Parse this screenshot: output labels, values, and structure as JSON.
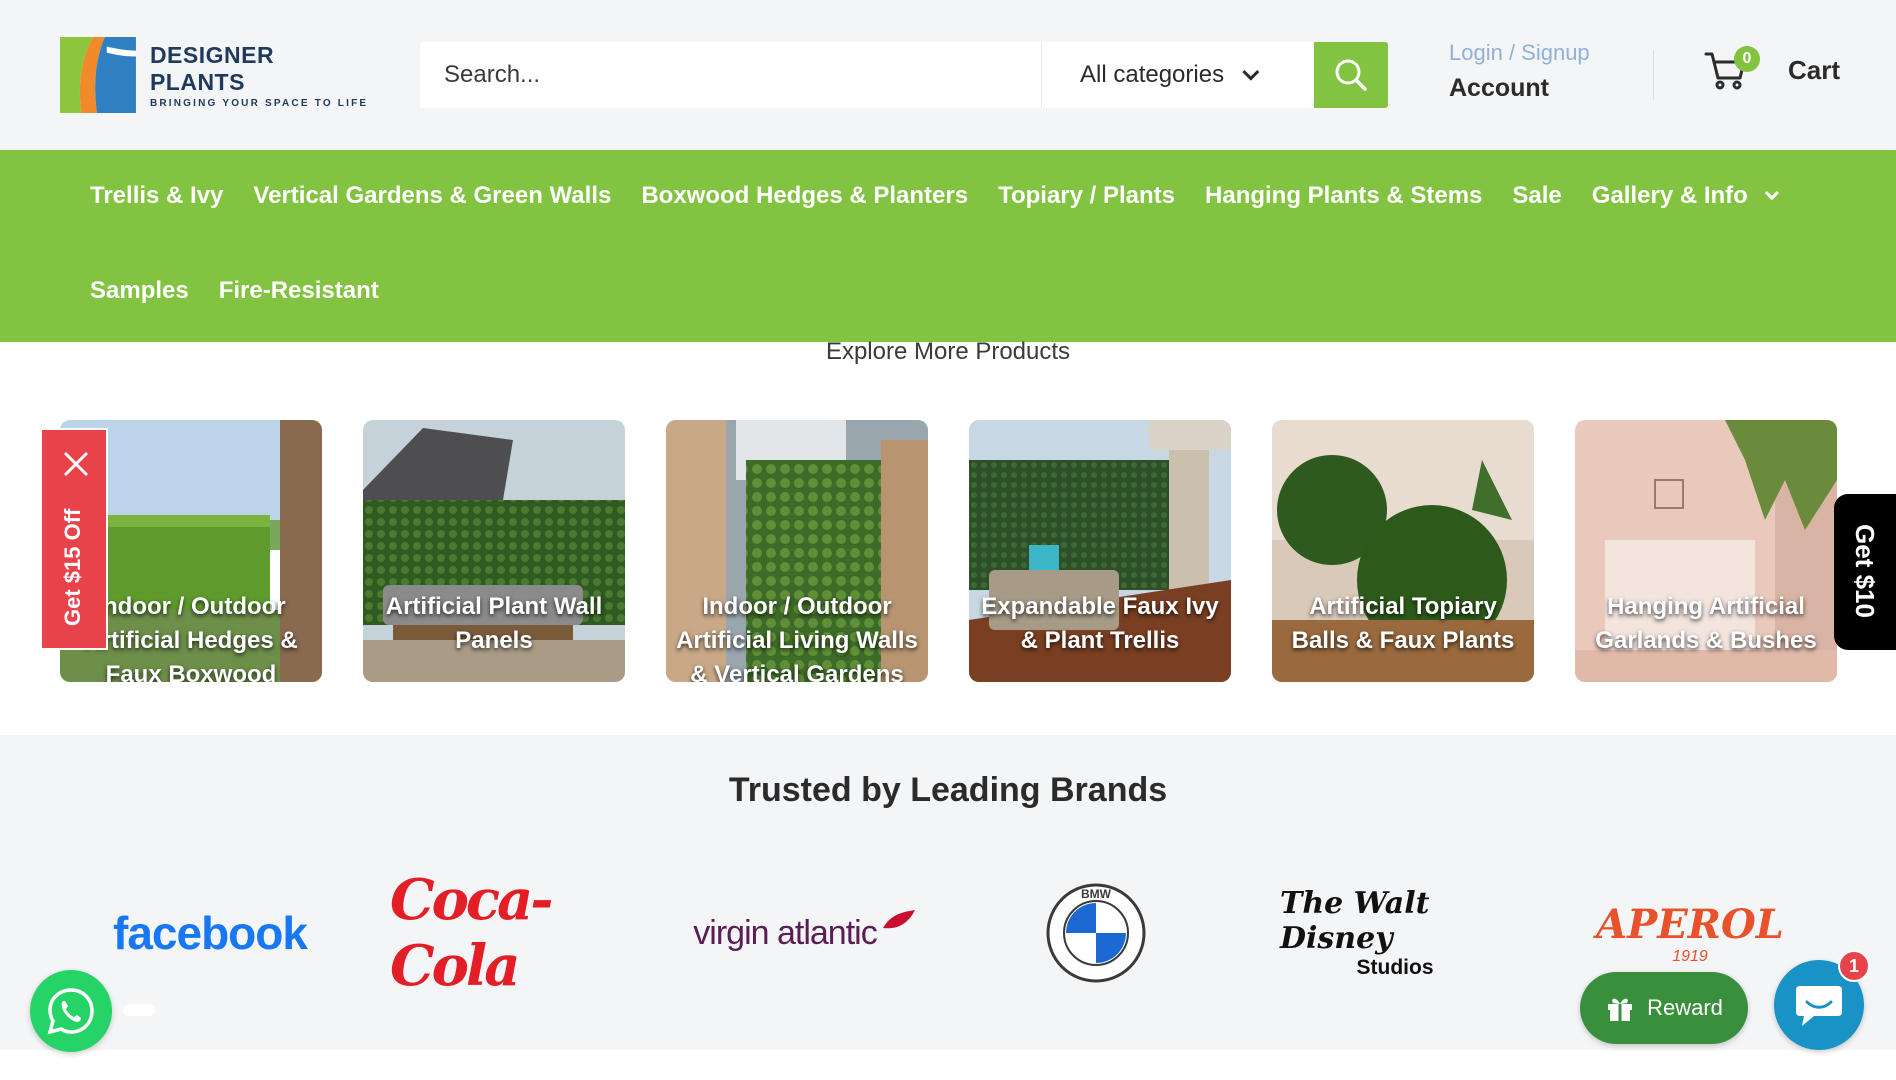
{
  "header": {
    "logo": {
      "name": "DESIGNER PLANTS",
      "tagline": "BRINGING YOUR SPACE TO LIFE"
    },
    "search": {
      "placeholder": "Search...",
      "category": "All categories"
    },
    "account": {
      "link": "Login / Signup",
      "label": "Account"
    },
    "cart": {
      "count": "0",
      "label": "Cart"
    }
  },
  "nav": {
    "row1": [
      {
        "label": "Trellis & Ivy"
      },
      {
        "label": "Vertical Gardens & Green Walls"
      },
      {
        "label": "Boxwood Hedges & Planters"
      },
      {
        "label": "Topiary / Plants"
      },
      {
        "label": "Hanging Plants & Stems"
      },
      {
        "label": "Sale"
      },
      {
        "label": "Gallery & Info"
      }
    ],
    "row2": [
      {
        "label": "Samples"
      },
      {
        "label": "Fire-Resistant"
      }
    ]
  },
  "explore": {
    "title": "Explore More Products",
    "tiles": [
      {
        "label": "Indoor / Outdoor Artificial Hedges & Faux Boxwood"
      },
      {
        "label": "Artificial Plant Wall Panels"
      },
      {
        "label": "Indoor / Outdoor Artificial Living Walls & Vertical Gardens"
      },
      {
        "label": "Expandable Faux Ivy & Plant Trellis"
      },
      {
        "label": "Artificial Topiary Balls & Faux Plants"
      },
      {
        "label": "Hanging Artificial Garlands & Bushes"
      }
    ]
  },
  "promos": {
    "left_tab": "Get $15 Off",
    "right_tab": "Get $10"
  },
  "brands": {
    "title": "Trusted by Leading Brands",
    "logos": {
      "facebook": "facebook",
      "cocacola": "Coca-Cola",
      "virgin": "virgin atlantic",
      "bmw": "BMW",
      "disney_top": "The Walt Disney",
      "disney_bottom": "Studios",
      "aperol": "APEROL",
      "aperol_year": "1919"
    }
  },
  "floating": {
    "reward": "Reward",
    "chat_badge": "1"
  },
  "colors": {
    "brand_green": "#82c341",
    "promo_red": "#e8434b",
    "chat_blue": "#1993c6"
  }
}
